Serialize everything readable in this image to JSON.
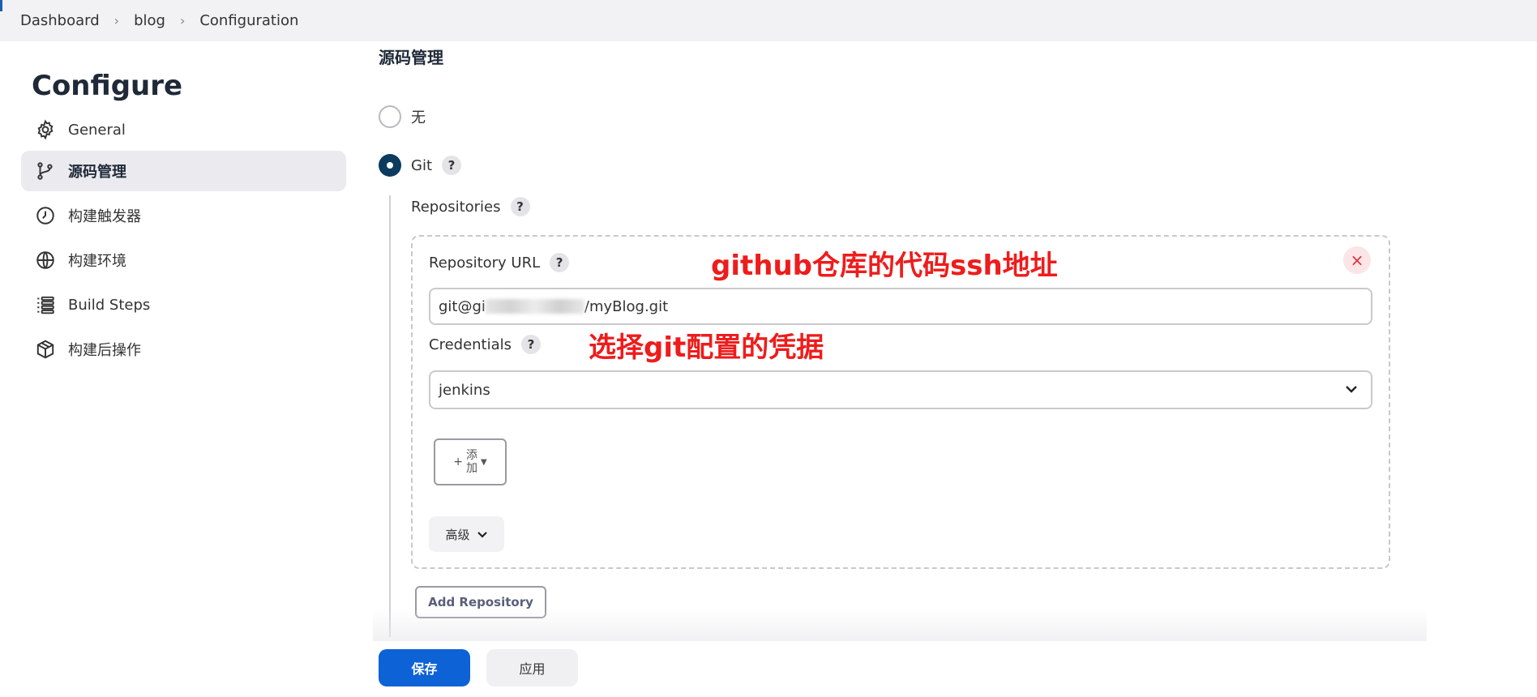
{
  "breadcrumb": [
    "Dashboard",
    "blog",
    "Configuration"
  ],
  "sidebar": {
    "title": "Configure",
    "items": [
      {
        "label": "General",
        "icon": "gear-icon"
      },
      {
        "label": "源码管理",
        "icon": "git-branch-icon",
        "active": true
      },
      {
        "label": "构建触发器",
        "icon": "clock-icon"
      },
      {
        "label": "构建环境",
        "icon": "globe-icon"
      },
      {
        "label": "Build Steps",
        "icon": "list-icon"
      },
      {
        "label": "构建后操作",
        "icon": "cube-icon"
      }
    ]
  },
  "scm": {
    "section_title": "源码管理",
    "option_none": "无",
    "option_git": "Git",
    "repositories_label": "Repositories",
    "repo_url_label": "Repository URL",
    "repo_url_prefix": "git@gi",
    "repo_url_suffix": "/myBlog.git",
    "credentials_label": "Credentials",
    "credentials_value": "jenkins",
    "add_button": [
      "添",
      "加"
    ],
    "advanced_button": "高级",
    "add_repository_button": "Add Repository",
    "help_glyph": "?",
    "close_glyph": "×"
  },
  "annotations": {
    "url_note": "github仓库的代码ssh地址",
    "credentials_note": "选择git配置的凭据"
  },
  "footer": {
    "save_label": "保存",
    "apply_label": "应用"
  },
  "colors": {
    "accent": "#0d62d6",
    "radio_checked": "#0b3b5e",
    "annotation": "#ee1c1c"
  }
}
